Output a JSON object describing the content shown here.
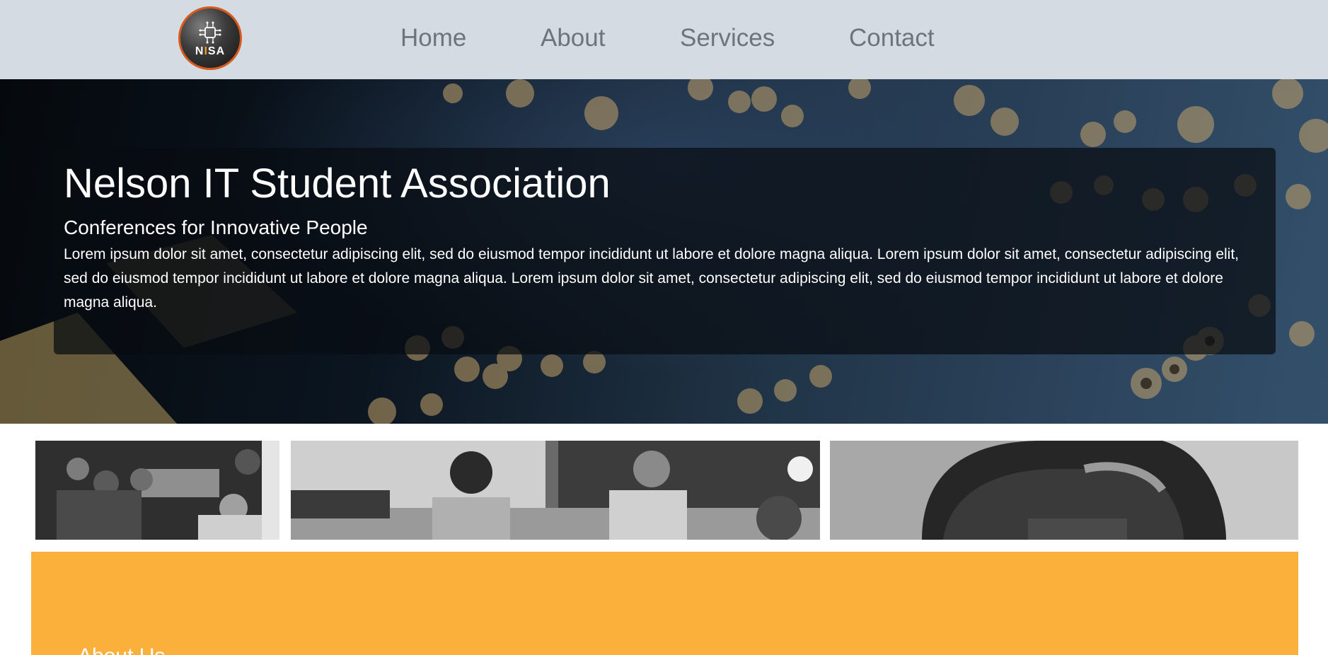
{
  "navbar": {
    "logo": {
      "text_prefix": "N",
      "text_accent": "I",
      "text_suffix": "SA",
      "icon": "circuit-chip-icon",
      "border_color": "#d55a1c",
      "accent_color": "#f59a22"
    },
    "links": [
      {
        "label": "Home"
      },
      {
        "label": "About"
      },
      {
        "label": "Services"
      },
      {
        "label": "Contact"
      }
    ],
    "background": "#d4dbe3",
    "link_color": "#6c757d"
  },
  "hero": {
    "title": "Nelson IT Student Association",
    "subtitle": "Conferences for Innovative People",
    "text": "Lorem ipsum dolor sit amet, consectetur adipiscing elit, sed do eiusmod tempor incididunt ut labore et dolore magna aliqua. Lorem ipsum dolor sit amet, consectetur adipiscing elit, sed do eiusmod tempor incididunt ut labore et dolore magna aliqua. Lorem ipsum dolor sit amet, consectetur adipiscing elit, sed do eiusmod tempor incididunt ut labore et dolore magna aliqua.",
    "background_image": "circuit-board-photo"
  },
  "photos": [
    {
      "name": "students-photo-1"
    },
    {
      "name": "students-photo-2"
    },
    {
      "name": "students-photo-3"
    }
  ],
  "about": {
    "heading": "About Us",
    "background": "#fbb03b"
  }
}
